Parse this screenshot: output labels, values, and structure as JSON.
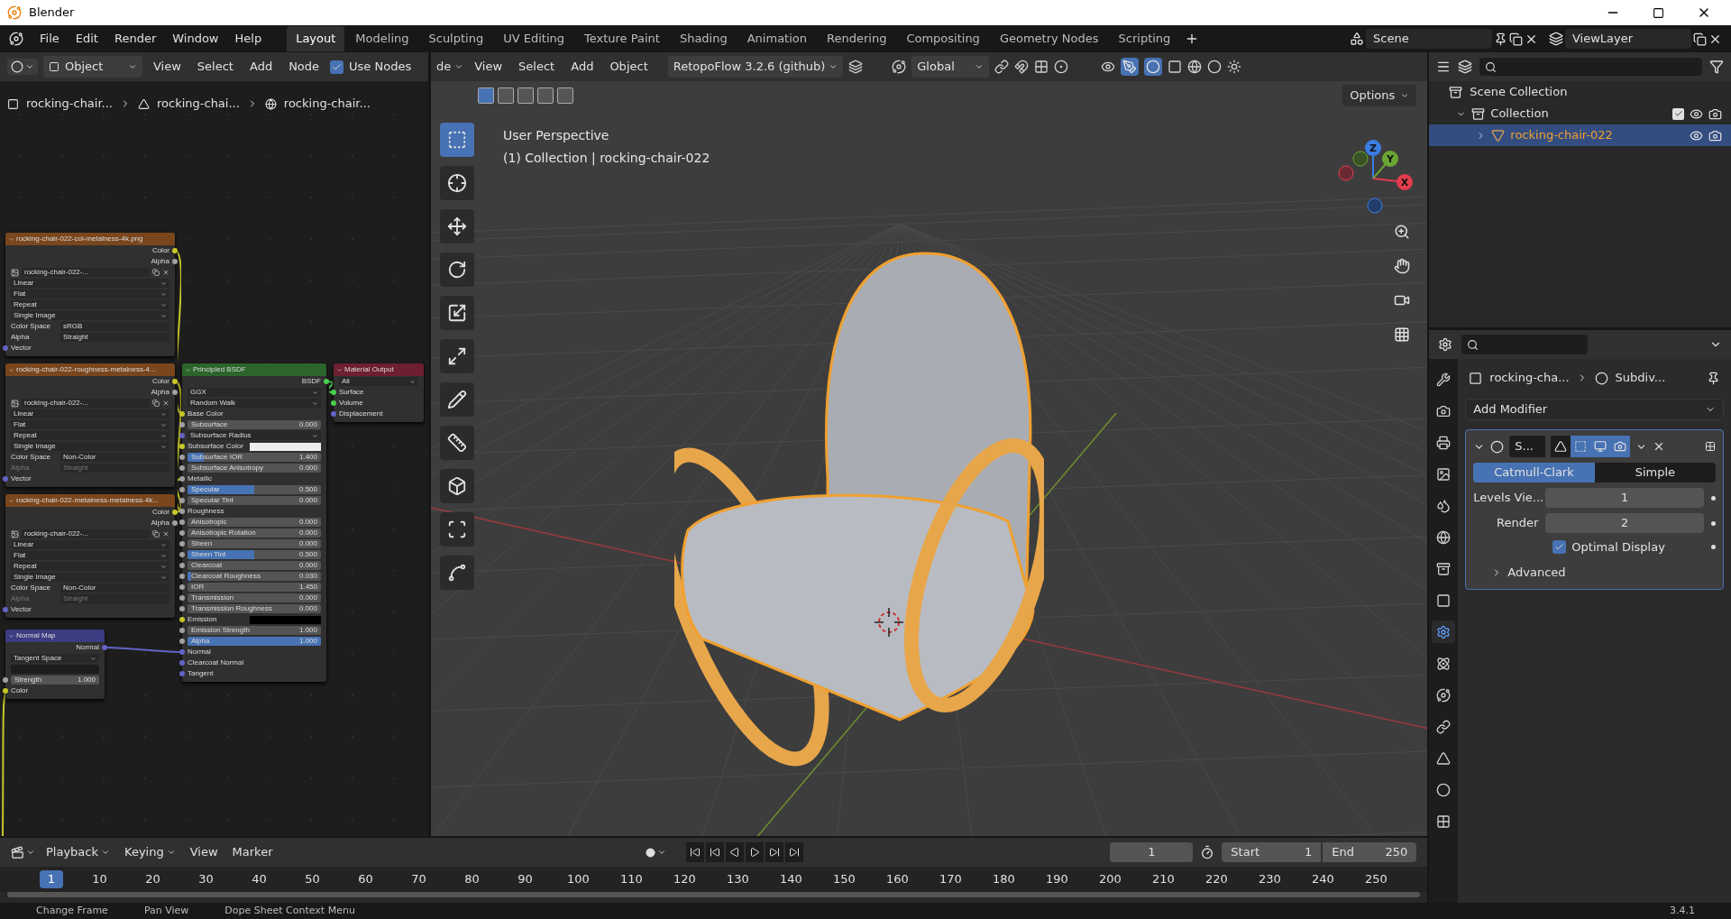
{
  "window": {
    "title": "Blender"
  },
  "menu": [
    "File",
    "Edit",
    "Render",
    "Window",
    "Help"
  ],
  "workspaces": [
    {
      "label": "Layout",
      "selected": true
    },
    {
      "label": "Modeling",
      "selected": false
    },
    {
      "label": "Sculpting",
      "selected": false
    },
    {
      "label": "UV Editing",
      "selected": false
    },
    {
      "label": "Texture Paint",
      "selected": false
    },
    {
      "label": "Shading",
      "selected": false
    },
    {
      "label": "Animation",
      "selected": false
    },
    {
      "label": "Rendering",
      "selected": false
    },
    {
      "label": "Compositing",
      "selected": false
    },
    {
      "label": "Geometry Nodes",
      "selected": false
    },
    {
      "label": "Scripting",
      "selected": false
    }
  ],
  "scene": "Scene",
  "view_layer": "ViewLayer",
  "node_editor": {
    "object_type": "Object",
    "menus": [
      "View",
      "Select",
      "Add",
      "Node"
    ],
    "use_nodes": {
      "label": "Use Nodes",
      "checked": true
    },
    "breadcrumbs": [
      "rocking-chair...",
      "rocking-chai...",
      "rocking-chair..."
    ],
    "nodes": [
      {
        "title": "rocking-chair-022-col-metalness-4k.png",
        "kind": "texture",
        "rows": [
          {
            "kind": "output",
            "label": "Color",
            "socket": {
              "color": "#c7c729"
            }
          },
          {
            "kind": "output",
            "label": "Alpha",
            "socket": {
              "color": "#a1a1a1"
            }
          },
          {
            "kind": "image",
            "value": "rocking-chair-022-..."
          },
          {
            "kind": "dropdown",
            "value": "Linear"
          },
          {
            "kind": "dropdown",
            "value": "Flat"
          },
          {
            "kind": "dropdown",
            "value": "Repeat"
          },
          {
            "kind": "dropdown",
            "value": "Single Image"
          },
          {
            "kind": "prop",
            "label": "Color Space",
            "value": "sRGB",
            "disabled": false
          },
          {
            "kind": "prop",
            "label": "Alpha",
            "value": "Straight",
            "disabled": false
          },
          {
            "kind": "input",
            "label": "Vector",
            "socket": {
              "color": "#6363c7"
            }
          }
        ]
      },
      {
        "title": "rocking-chair-022-roughness-metalness-4...",
        "kind": "texture",
        "rows": [
          {
            "kind": "output",
            "label": "Color",
            "socket": {
              "color": "#c7c729"
            }
          },
          {
            "kind": "output",
            "label": "Alpha",
            "socket": {
              "color": "#a1a1a1"
            }
          },
          {
            "kind": "image",
            "value": "rocking-chair-022-..."
          },
          {
            "kind": "dropdown",
            "value": "Linear"
          },
          {
            "kind": "dropdown",
            "value": "Flat"
          },
          {
            "kind": "dropdown",
            "value": "Repeat"
          },
          {
            "kind": "dropdown",
            "value": "Single Image"
          },
          {
            "kind": "prop",
            "label": "Color Space",
            "value": "Non-Color",
            "disabled": false
          },
          {
            "kind": "prop",
            "label": "Alpha",
            "value": "Straight",
            "disabled": true
          },
          {
            "kind": "input",
            "label": "Vector",
            "socket": {
              "color": "#6363c7"
            }
          }
        ]
      },
      {
        "title": "rocking-chair-022-metalness-metalness-4k...",
        "kind": "texture",
        "rows": [
          {
            "kind": "output",
            "label": "Color",
            "socket": {
              "color": "#c7c729"
            }
          },
          {
            "kind": "output",
            "label": "Alpha",
            "socket": {
              "color": "#a1a1a1"
            }
          },
          {
            "kind": "image",
            "value": "rocking-chair-022-..."
          },
          {
            "kind": "dropdown",
            "value": "Linear"
          },
          {
            "kind": "dropdown",
            "value": "Flat"
          },
          {
            "kind": "dropdown",
            "value": "Repeat"
          },
          {
            "kind": "dropdown",
            "value": "Single Image"
          },
          {
            "kind": "prop",
            "label": "Color Space",
            "value": "Non-Color",
            "disabled": false
          },
          {
            "kind": "prop",
            "label": "Alpha",
            "value": "Straight",
            "disabled": true
          },
          {
            "kind": "input",
            "label": "Vector",
            "socket": {
              "color": "#6363c7"
            }
          }
        ]
      },
      {
        "title": "Normal Map",
        "kind": "vector",
        "rows": [
          {
            "kind": "output",
            "label": "Normal",
            "socket": {
              "color": "#6363c7"
            }
          },
          {
            "kind": "dropdown",
            "value": "Tangent Space"
          },
          {
            "kind": "field"
          },
          {
            "kind": "slider",
            "label": "Strength",
            "value": "1.000",
            "socket": {
              "color": "#a1a1a1"
            }
          },
          {
            "kind": "input",
            "label": "Color",
            "socket": {
              "color": "#c7c729"
            }
          }
        ]
      },
      {
        "title": "Principled BSDF",
        "kind": "shader",
        "rows": [
          {
            "kind": "output",
            "label": "BSDF",
            "socket": {
              "color": "#4dce4d"
            }
          },
          {
            "kind": "dropdown",
            "value": "GGX"
          },
          {
            "kind": "dropdown",
            "value": "Random Walk"
          },
          {
            "kind": "input",
            "label": "Base Color",
            "socket": {
              "color": "#c7c729"
            }
          },
          {
            "kind": "slider",
            "label": "Subsurface",
            "value": "0.000",
            "socket": {
              "color": "#a1a1a1"
            }
          },
          {
            "kind": "dropdown",
            "value": "Subsurface Radius",
            "socket": {
              "color": "#6363c7"
            }
          },
          {
            "kind": "swatch",
            "label": "Subsurface Color",
            "color": "#eeeeee",
            "socket": {
              "color": "#c7c729"
            }
          },
          {
            "kind": "slider",
            "label": "Subsurface IOR",
            "value": "1.400",
            "level": 0.12,
            "socket": {
              "color": "#a1a1a1"
            }
          },
          {
            "kind": "slider",
            "label": "Subsurface Anisotropy",
            "value": "0.000",
            "socket": {
              "color": "#a1a1a1"
            }
          },
          {
            "kind": "input",
            "label": "Metallic",
            "socket": {
              "color": "#a1a1a1"
            }
          },
          {
            "kind": "slider",
            "label": "Specular",
            "value": "0.500",
            "level": 0.5,
            "socket": {
              "color": "#a1a1a1"
            }
          },
          {
            "kind": "slider",
            "label": "Specular Tint",
            "value": "0.000",
            "socket": {
              "color": "#a1a1a1"
            }
          },
          {
            "kind": "input",
            "label": "Roughness",
            "socket": {
              "color": "#a1a1a1"
            }
          },
          {
            "kind": "slider",
            "label": "Anisotropic",
            "value": "0.000",
            "socket": {
              "color": "#a1a1a1"
            }
          },
          {
            "kind": "slider",
            "label": "Anisotropic Rotation",
            "value": "0.000",
            "socket": {
              "color": "#a1a1a1"
            }
          },
          {
            "kind": "slider",
            "label": "Sheen",
            "value": "0.000",
            "socket": {
              "color": "#a1a1a1"
            }
          },
          {
            "kind": "slider",
            "label": "Sheen Tint",
            "value": "0.500",
            "level": 0.5,
            "socket": {
              "color": "#a1a1a1"
            }
          },
          {
            "kind": "slider",
            "label": "Clearcoat",
            "value": "0.000",
            "socket": {
              "color": "#a1a1a1"
            }
          },
          {
            "kind": "slider",
            "label": "Clearcoat Roughness",
            "value": "0.030",
            "level": 0.03,
            "socket": {
              "color": "#a1a1a1"
            }
          },
          {
            "kind": "slider",
            "label": "IOR",
            "value": "1.450",
            "socket": {
              "color": "#a1a1a1"
            }
          },
          {
            "kind": "slider",
            "label": "Transmission",
            "value": "0.000",
            "socket": {
              "color": "#a1a1a1"
            }
          },
          {
            "kind": "slider",
            "label": "Transmission Roughness",
            "value": "0.000",
            "socket": {
              "color": "#a1a1a1"
            }
          },
          {
            "kind": "swatch",
            "label": "Emission",
            "color": "#000000",
            "socket": {
              "color": "#c7c729"
            }
          },
          {
            "kind": "slider",
            "label": "Emission Strength",
            "value": "1.000",
            "socket": {
              "color": "#a1a1a1"
            }
          },
          {
            "kind": "slider",
            "label": "Alpha",
            "value": "1.000",
            "level": 1,
            "socket": {
              "color": "#a1a1a1"
            }
          },
          {
            "kind": "input",
            "label": "Normal",
            "socket": {
              "color": "#6363c7"
            }
          },
          {
            "kind": "input",
            "label": "Clearcoat Normal",
            "socket": {
              "color": "#6363c7"
            }
          },
          {
            "kind": "input",
            "label": "Tangent",
            "socket": {
              "color": "#6363c7"
            }
          }
        ]
      },
      {
        "title": "Material Output",
        "kind": "output",
        "rows": [
          {
            "kind": "dropdown",
            "value": "All"
          },
          {
            "kind": "input",
            "label": "Surface",
            "socket": {
              "color": "#4dce4d"
            }
          },
          {
            "kind": "input",
            "label": "Volume",
            "socket": {
              "color": "#4dce4d"
            }
          },
          {
            "kind": "input",
            "label": "Displacement",
            "socket": {
              "color": "#6363c7"
            }
          }
        ]
      }
    ]
  },
  "viewport": {
    "mode": "de",
    "menus": [
      "View",
      "Select",
      "Add",
      "Object"
    ],
    "addon": "RetopoFlow 3.2.6 (github)",
    "orientation": "Global",
    "options": "Options",
    "view_name": "User Perspective",
    "collection_info": "(1) Collection | rocking-chair-022",
    "tools": [
      {
        "selected": true
      },
      {
        "selected": false
      },
      {
        "selected": false
      },
      {
        "selected": false
      },
      {
        "selected": false
      },
      {
        "selected": false
      },
      {
        "selected": false
      },
      {
        "selected": false
      },
      {
        "selected": false
      },
      {
        "selected": false
      },
      {
        "selected": false
      }
    ],
    "gizmo": {
      "z": "Z",
      "y": "Y",
      "x": "X"
    }
  },
  "outliner": {
    "root": "Scene Collection",
    "collection": {
      "label": "Collection",
      "checked": true
    },
    "objects": [
      {
        "label": "rocking-chair-022",
        "selected": true
      }
    ]
  },
  "properties": {
    "tabs": [
      {
        "selected": false
      },
      {
        "selected": false
      },
      {
        "selected": false
      },
      {
        "selected": false
      },
      {
        "selected": false
      },
      {
        "selected": false
      },
      {
        "selected": false
      },
      {
        "selected": false
      },
      {
        "selected": true
      },
      {
        "selected": false
      },
      {
        "selected": false
      },
      {
        "selected": false
      },
      {
        "selected": false
      },
      {
        "selected": false
      },
      {
        "selected": false
      }
    ],
    "breadcrumb": [
      "rocking-cha...",
      "Subdiv..."
    ],
    "add_modifier": "Add Modifier",
    "modifier": {
      "name": "S...",
      "toggles": [
        {
          "on": false
        },
        {
          "on": true
        },
        {
          "on": true
        },
        {
          "on": true
        }
      ],
      "types": [
        {
          "label": "Catmull-Clark",
          "selected": true
        },
        {
          "label": "Simple",
          "selected": false
        }
      ],
      "fields": [
        {
          "label": "Levels Vie...",
          "value": "1"
        },
        {
          "label": "Render",
          "value": "2"
        }
      ],
      "optimal_display": {
        "label": "Optimal Display",
        "checked": true
      },
      "advanced": "Advanced"
    }
  },
  "timeline": {
    "menus": [
      "Playback",
      "Keying",
      "View",
      "Marker"
    ],
    "current_frame": "1",
    "start": {
      "label": "Start",
      "value": "1"
    },
    "end": {
      "label": "End",
      "value": "250"
    },
    "frames": [
      {
        "label": "1",
        "selected": true
      },
      {
        "label": "10",
        "selected": false
      },
      {
        "label": "20",
        "selected": false
      },
      {
        "label": "30",
        "selected": false
      },
      {
        "label": "40",
        "selected": false
      },
      {
        "label": "50",
        "selected": false
      },
      {
        "label": "60",
        "selected": false
      },
      {
        "label": "70",
        "selected": false
      },
      {
        "label": "80",
        "selected": false
      },
      {
        "label": "90",
        "selected": false
      },
      {
        "label": "100",
        "selected": false
      },
      {
        "label": "110",
        "selected": false
      },
      {
        "label": "120",
        "selected": false
      },
      {
        "label": "130",
        "selected": false
      },
      {
        "label": "140",
        "selected": false
      },
      {
        "label": "150",
        "selected": false
      },
      {
        "label": "160",
        "selected": false
      },
      {
        "label": "170",
        "selected": false
      },
      {
        "label": "180",
        "selected": false
      },
      {
        "label": "190",
        "selected": false
      },
      {
        "label": "200",
        "selected": false
      },
      {
        "label": "210",
        "selected": false
      },
      {
        "label": "220",
        "selected": false
      },
      {
        "label": "230",
        "selected": false
      },
      {
        "label": "240",
        "selected": false
      },
      {
        "label": "250",
        "selected": false
      }
    ]
  },
  "status_bar": {
    "hints": [
      "Change Frame",
      "Pan View",
      "Dope Sheet Context Menu"
    ],
    "version": "3.4.1"
  }
}
